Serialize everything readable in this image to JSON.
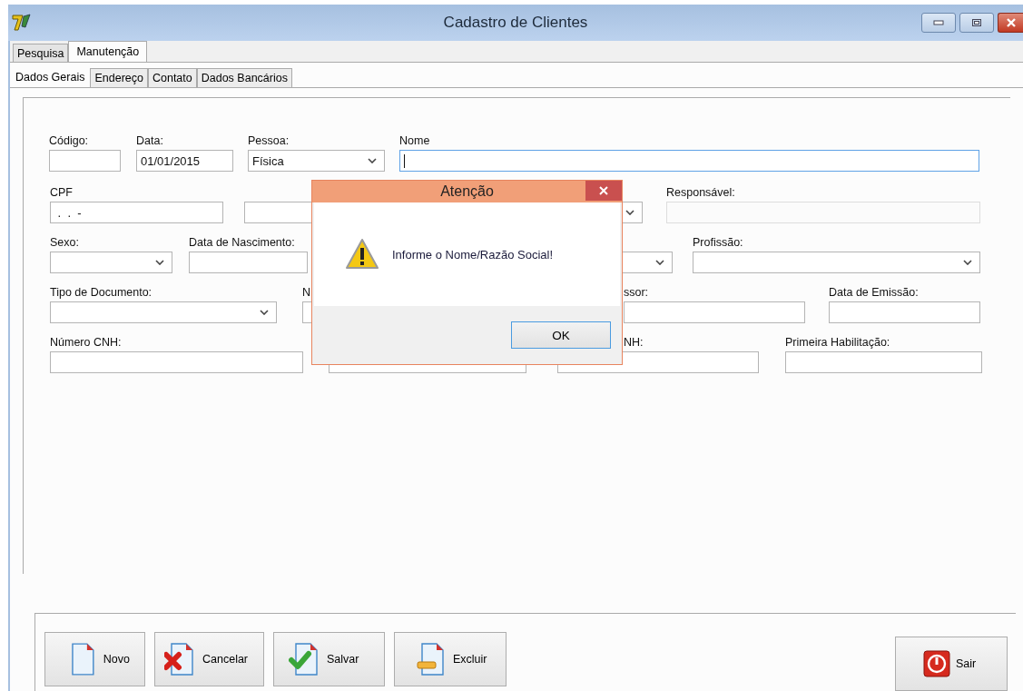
{
  "window": {
    "title": "Cadastro de Clientes"
  },
  "tabs": [
    {
      "label": "Pesquisa",
      "selected": false
    },
    {
      "label": "Manutenção",
      "selected": true
    }
  ],
  "subtabs": [
    {
      "label": "Dados Gerais",
      "selected": true
    },
    {
      "label": "Endereço",
      "selected": false
    },
    {
      "label": "Contato",
      "selected": false
    },
    {
      "label": "Dados Bancários",
      "selected": false
    }
  ],
  "form_rows": [
    [
      {
        "kind": "text",
        "label": "Código:"
      },
      {
        "kind": "text",
        "label": "Data:",
        "value": "01/01/2015"
      },
      {
        "kind": "combo",
        "label": "Pessoa:",
        "value": "Física"
      },
      {
        "kind": "text",
        "label": "Nome",
        "focused": true
      }
    ],
    [
      {
        "kind": "text",
        "label": "CPF",
        "value": " .  .  -"
      },
      {
        "kind": "text"
      },
      {
        "kind": "combo"
      },
      {
        "kind": "text",
        "label": "Responsável:",
        "disabled": true
      }
    ],
    [
      {
        "kind": "combo",
        "label": "Sexo:"
      },
      {
        "kind": "text",
        "label": "Data de Nascimento:"
      },
      {
        "kind": "combo"
      },
      {
        "kind": "combo",
        "label": "Profissão:"
      }
    ],
    [
      {
        "kind": "combo",
        "label": "Tipo de Documento:"
      },
      {
        "kind": "text",
        "label": "N"
      },
      {
        "kind": "text",
        "label": "ssor:"
      },
      {
        "kind": "text",
        "label": "Data de Emissão:"
      }
    ],
    [
      {
        "kind": "text",
        "label": "Número CNH:"
      },
      {
        "kind": "text"
      },
      {
        "kind": "text",
        "label": "NH:"
      },
      {
        "kind": "text",
        "label": "Primeira Habilitação:"
      }
    ]
  ],
  "dialog": {
    "title": "Atenção",
    "message": "Informe o Nome/Razão Social!",
    "button": "OK"
  },
  "buttons": [
    {
      "kind": "new",
      "label": "Novo"
    },
    {
      "kind": "cancel",
      "label": "Cancelar"
    },
    {
      "kind": "save",
      "label": "Salvar"
    },
    {
      "kind": "delete",
      "label": "Excluir"
    }
  ],
  "exit_button": {
    "label": "Sair"
  }
}
